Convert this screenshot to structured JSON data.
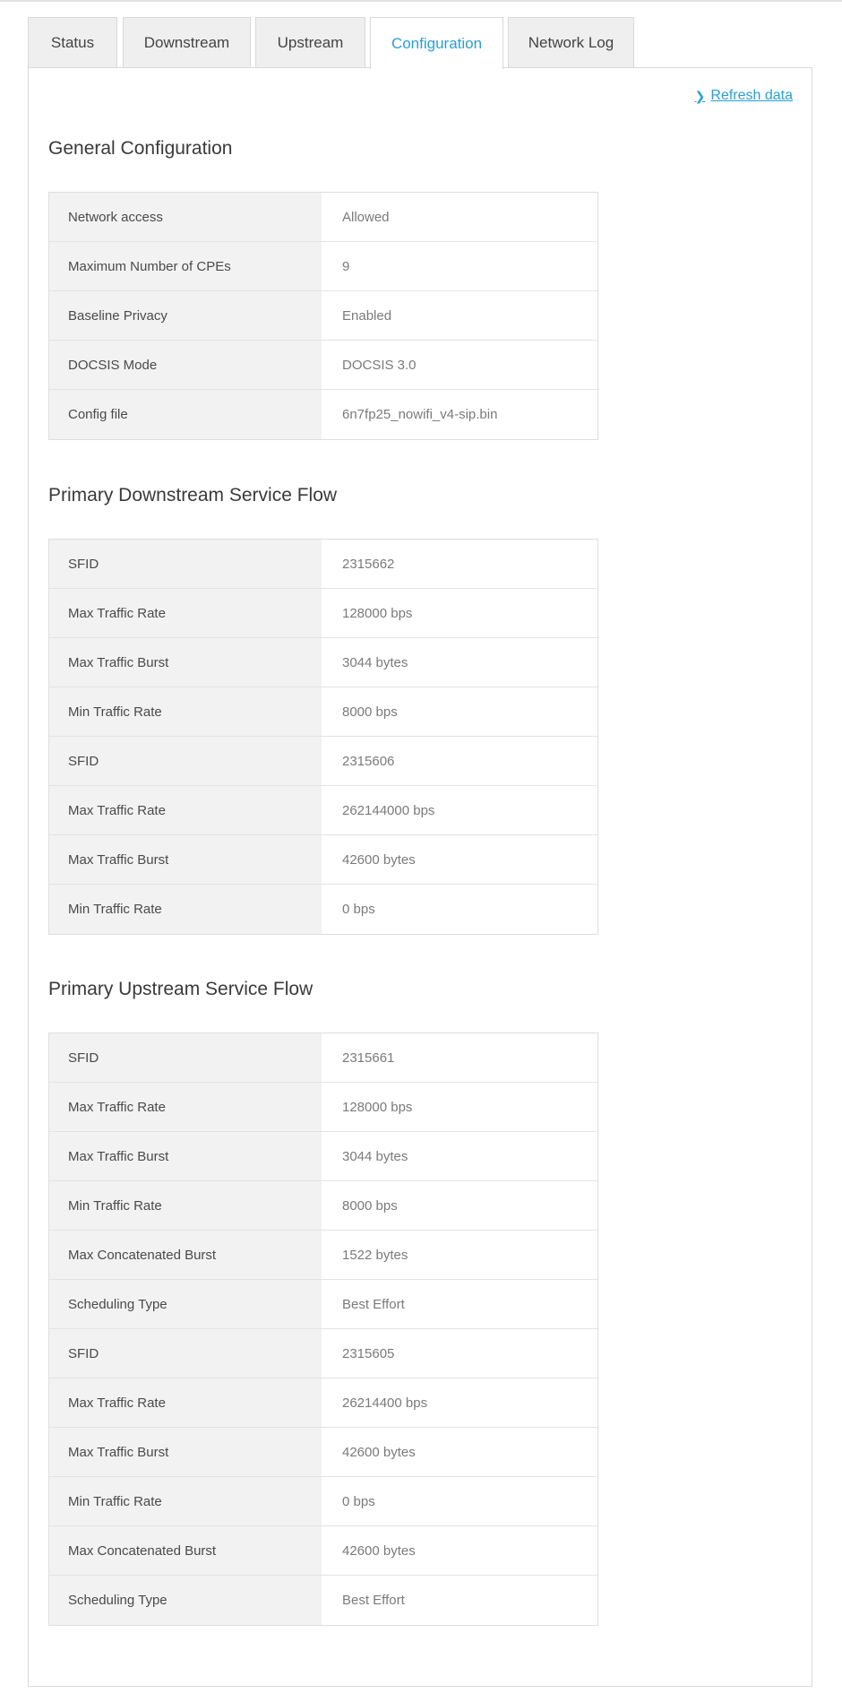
{
  "tabs": [
    {
      "label": "Status",
      "active": false
    },
    {
      "label": "Downstream",
      "active": false
    },
    {
      "label": "Upstream",
      "active": false
    },
    {
      "label": "Configuration",
      "active": true
    },
    {
      "label": "Network Log",
      "active": false
    }
  ],
  "refresh_label": "Refresh data",
  "sections": [
    {
      "title": "General Configuration",
      "rows": [
        {
          "label": "Network access",
          "value": "Allowed"
        },
        {
          "label": "Maximum Number of CPEs",
          "value": "9"
        },
        {
          "label": "Baseline Privacy",
          "value": "Enabled"
        },
        {
          "label": "DOCSIS Mode",
          "value": "DOCSIS 3.0"
        },
        {
          "label": "Config file",
          "value": "6n7fp25_nowifi_v4-sip.bin"
        }
      ]
    },
    {
      "title": "Primary Downstream Service Flow",
      "rows": [
        {
          "label": "SFID",
          "value": "2315662"
        },
        {
          "label": "Max Traffic Rate",
          "value": "128000 bps"
        },
        {
          "label": "Max Traffic Burst",
          "value": "3044 bytes"
        },
        {
          "label": "Min Traffic Rate",
          "value": "8000 bps"
        },
        {
          "label": "SFID",
          "value": "2315606"
        },
        {
          "label": "Max Traffic Rate",
          "value": "262144000 bps"
        },
        {
          "label": "Max Traffic Burst",
          "value": "42600 bytes"
        },
        {
          "label": "Min Traffic Rate",
          "value": "0 bps"
        }
      ]
    },
    {
      "title": "Primary Upstream Service Flow",
      "rows": [
        {
          "label": "SFID",
          "value": "2315661"
        },
        {
          "label": "Max Traffic Rate",
          "value": "128000 bps"
        },
        {
          "label": "Max Traffic Burst",
          "value": "3044 bytes"
        },
        {
          "label": "Min Traffic Rate",
          "value": "8000 bps"
        },
        {
          "label": "Max Concatenated Burst",
          "value": "1522 bytes"
        },
        {
          "label": "Scheduling Type",
          "value": "Best Effort"
        },
        {
          "label": "SFID",
          "value": "2315605"
        },
        {
          "label": "Max Traffic Rate",
          "value": "26214400 bps"
        },
        {
          "label": "Max Traffic Burst",
          "value": "42600 bytes"
        },
        {
          "label": "Min Traffic Rate",
          "value": "0 bps"
        },
        {
          "label": "Max Concatenated Burst",
          "value": "42600 bytes"
        },
        {
          "label": "Scheduling Type",
          "value": "Best Effort"
        }
      ]
    }
  ]
}
